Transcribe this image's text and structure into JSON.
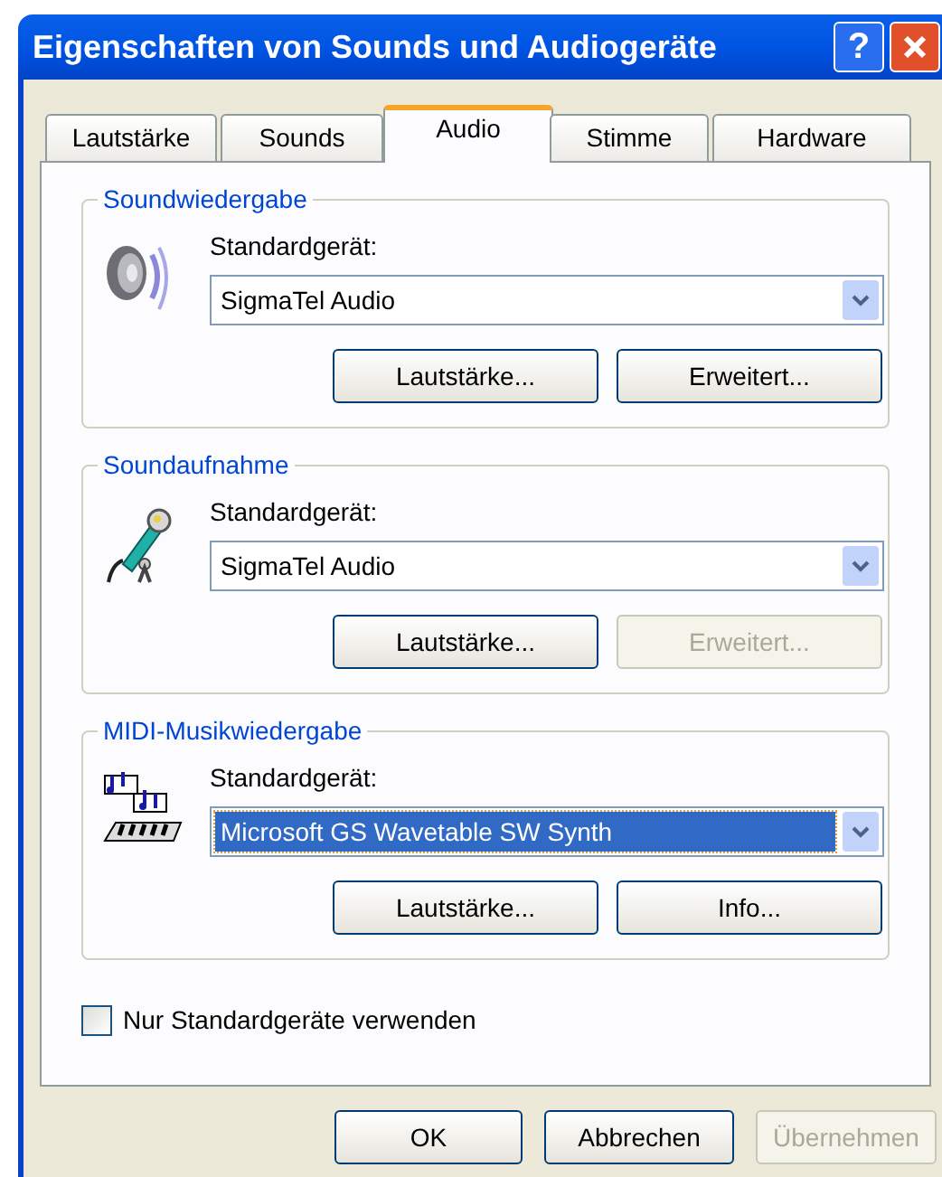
{
  "window": {
    "title": "Eigenschaften von Sounds und Audiogeräte",
    "help_button": "?"
  },
  "tabs": [
    {
      "label": "Lautstärke",
      "selected": false
    },
    {
      "label": "Sounds",
      "selected": false
    },
    {
      "label": "Audio",
      "selected": true
    },
    {
      "label": "Stimme",
      "selected": false
    },
    {
      "label": "Hardware",
      "selected": false
    }
  ],
  "groups": [
    {
      "title": "Soundwiedergabe",
      "kind": "speaker",
      "label": "Standardgerät:",
      "device": "SigmaTel Audio",
      "focused": false,
      "buttons": [
        {
          "label": "Lautstärke...",
          "disabled": false
        },
        {
          "label": "Erweitert...",
          "disabled": false
        }
      ]
    },
    {
      "title": "Soundaufnahme",
      "kind": "microphone",
      "label": "Standardgerät:",
      "device": "SigmaTel Audio",
      "focused": false,
      "buttons": [
        {
          "label": "Lautstärke...",
          "disabled": false
        },
        {
          "label": "Erweitert...",
          "disabled": true
        }
      ]
    },
    {
      "title": "MIDI-Musikwiedergabe",
      "kind": "midi",
      "label": "Standardgerät:",
      "device": "Microsoft GS Wavetable SW Synth",
      "focused": true,
      "buttons": [
        {
          "label": "Lautstärke...",
          "disabled": false
        },
        {
          "label": "Info...",
          "disabled": false
        }
      ]
    }
  ],
  "checkbox": {
    "label": "Nur Standardgeräte verwenden",
    "checked": false
  },
  "buttons": [
    {
      "label": "OK",
      "disabled": false
    },
    {
      "label": "Abbrechen",
      "disabled": false
    },
    {
      "label": "Übernehmen",
      "disabled": true
    }
  ]
}
